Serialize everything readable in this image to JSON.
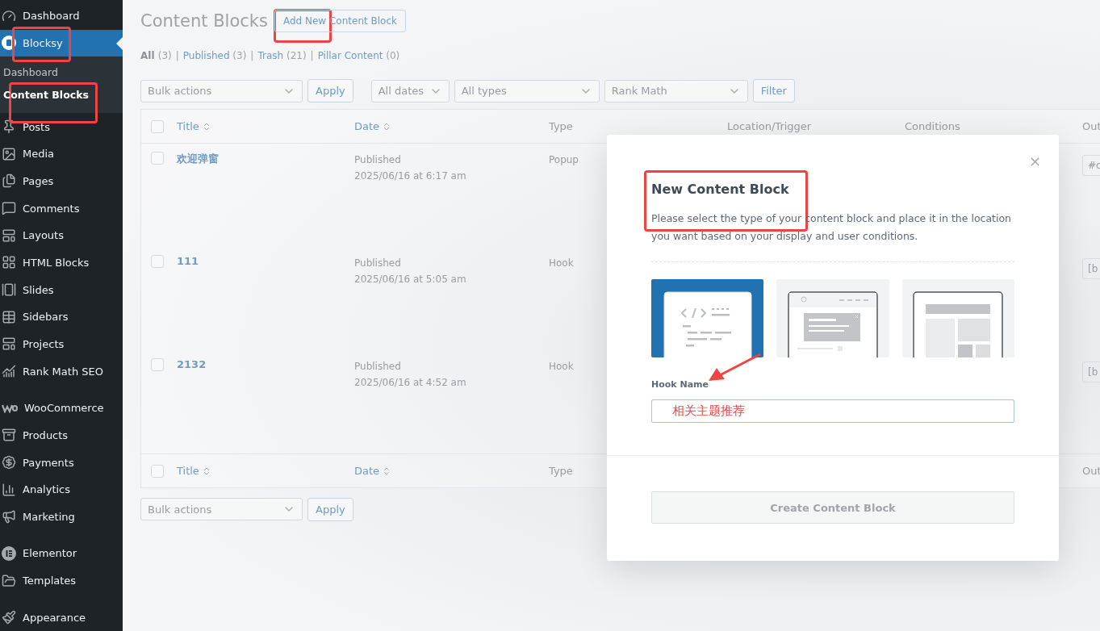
{
  "sidebar": {
    "items": [
      {
        "label": "Dashboard",
        "selected": false,
        "gap_before": false
      },
      {
        "label": "Blocksy",
        "selected": true,
        "gap_before": false,
        "children": [
          {
            "label": "Dashboard",
            "selected": false
          },
          {
            "label": "Content Blocks",
            "selected": true
          }
        ]
      },
      {
        "label": "Posts",
        "selected": false,
        "gap_before": false
      },
      {
        "label": "Media",
        "selected": false,
        "gap_before": false
      },
      {
        "label": "Pages",
        "selected": false,
        "gap_before": false
      },
      {
        "label": "Comments",
        "selected": false,
        "gap_before": false
      },
      {
        "label": "Layouts",
        "selected": false,
        "gap_before": false
      },
      {
        "label": "HTML Blocks",
        "selected": false,
        "gap_before": false
      },
      {
        "label": "Slides",
        "selected": false,
        "gap_before": false
      },
      {
        "label": "Sidebars",
        "selected": false,
        "gap_before": false
      },
      {
        "label": "Projects",
        "selected": false,
        "gap_before": false
      },
      {
        "label": "Rank Math SEO",
        "selected": false,
        "gap_before": false
      },
      {
        "label": "WooCommerce",
        "selected": false,
        "gap_before": true
      },
      {
        "label": "Products",
        "selected": false,
        "gap_before": false
      },
      {
        "label": "Payments",
        "selected": false,
        "gap_before": false
      },
      {
        "label": "Analytics",
        "selected": false,
        "gap_before": false
      },
      {
        "label": "Marketing",
        "selected": false,
        "gap_before": false
      },
      {
        "label": "Elementor",
        "selected": false,
        "gap_before": true
      },
      {
        "label": "Templates",
        "selected": false,
        "gap_before": false
      },
      {
        "label": "Appearance",
        "selected": false,
        "gap_before": true
      }
    ]
  },
  "page": {
    "title": "Content Blocks",
    "add_button": "Add New Content Block",
    "filters": [
      {
        "label": "All",
        "count": "(3)",
        "selected": true
      },
      {
        "separator": "|",
        "label": "Published",
        "count": "(3)",
        "selected": false
      },
      {
        "separator": "|",
        "label": "Trash",
        "count": "(21)",
        "selected": false
      },
      {
        "separator": "|",
        "label": "Pillar Content",
        "count": "(0)",
        "selected": false
      }
    ],
    "bulk_action": "Bulk actions",
    "apply": "Apply",
    "date_filter": "All dates",
    "type_filter": "All types",
    "seo_filter": "Rank Math",
    "filter_button": "Filter"
  },
  "table": {
    "select_all_checked": false,
    "columns": [
      {
        "label": "Title",
        "sortable": true
      },
      {
        "label": "Date",
        "sortable": true
      },
      {
        "label": "Type",
        "sortable": false
      },
      {
        "label": "Location/Trigger",
        "sortable": false
      },
      {
        "label": "Conditions",
        "sortable": false
      },
      {
        "label": "Out",
        "sortable": false
      }
    ],
    "rows": [
      {
        "checked": false,
        "title": "欢迎弹窗",
        "status": "Published",
        "date": "2025/06/16 at 6:17 am",
        "type": "Popup",
        "column_6": "#c"
      },
      {
        "checked": false,
        "title": "111",
        "status": "Published",
        "date": "2025/06/16 at 5:05 am",
        "type": "Hook",
        "column_6": "[b"
      },
      {
        "checked": false,
        "title": "2132",
        "status": "Published",
        "date": "2025/06/16 at 4:52 am",
        "type": "Hook",
        "column_6": "[b"
      }
    ],
    "footer_columns": [
      {
        "label": "Title",
        "sortable": true
      },
      {
        "label": "Date",
        "sortable": true
      },
      {
        "label": "Type",
        "sortable": false
      },
      {
        "label": "Out",
        "sortable": false
      }
    ],
    "bulk_action": "Bulk actions",
    "apply": "Apply"
  },
  "modal": {
    "close": "×",
    "title": "New Content Block",
    "description": "Please select the type of your content block and place it in the location you want based on your display and user conditions.",
    "types": [
      {
        "kind": "hook",
        "selected": true
      },
      {
        "kind": "popup",
        "selected": false
      },
      {
        "kind": "page",
        "selected": false
      }
    ],
    "field_label": "Hook Name",
    "field_value": "相关主题推荐",
    "create_button": "Create Content Block",
    "create_disabled": true
  }
}
